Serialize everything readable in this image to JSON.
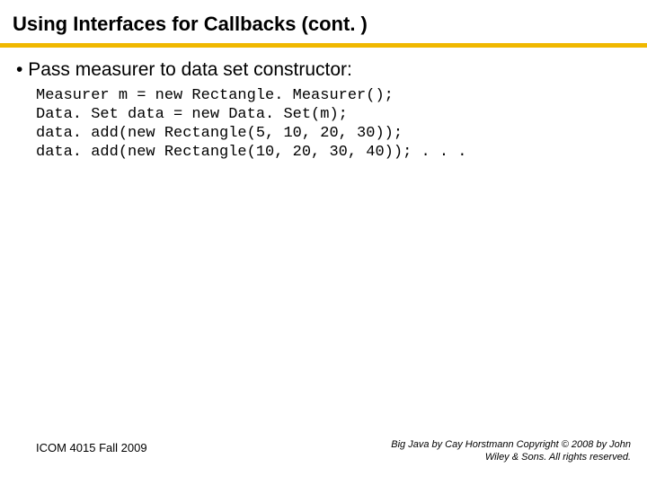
{
  "title": "Using Interfaces for Callbacks  (cont. )",
  "bullet": "Pass measurer to data set constructor:",
  "code": "Measurer m = new Rectangle. Measurer();\nData. Set data = new Data. Set(m);\ndata. add(new Rectangle(5, 10, 20, 30));\ndata. add(new Rectangle(10, 20, 30, 40)); . . .",
  "footer_left": "ICOM 4015 Fall 2009",
  "footer_right": "Big Java by Cay Horstmann Copyright © 2008 by John Wiley & Sons.  All rights reserved."
}
